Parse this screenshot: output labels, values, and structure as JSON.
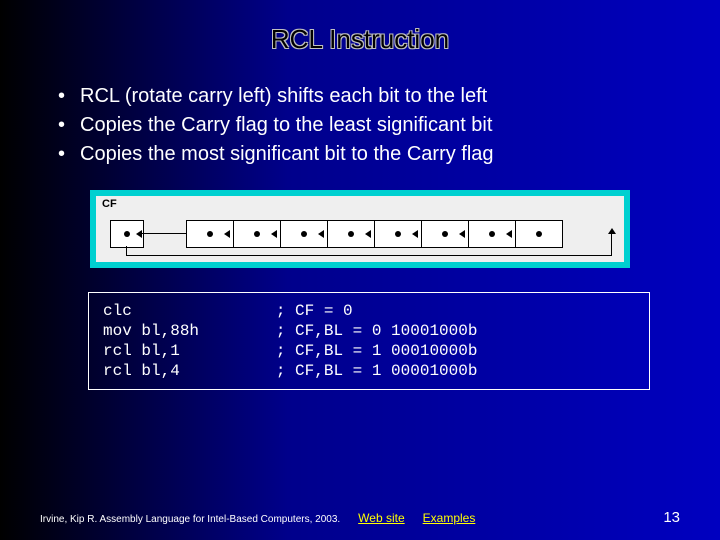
{
  "title": "RCL Instruction",
  "bullets": [
    "RCL (rotate carry left) shifts each bit to the left",
    "Copies the Carry flag to the least significant bit",
    "Copies the most significant bit to the Carry flag"
  ],
  "diagram": {
    "cf_label": "CF",
    "bit_count": 8
  },
  "code_lines": [
    {
      "instr": "clc",
      "comment": "; CF = 0"
    },
    {
      "instr": "mov bl,88h",
      "comment": "; CF,BL = 0 10001000b"
    },
    {
      "instr": "rcl bl,1",
      "comment": "; CF,BL = 1 00010000b"
    },
    {
      "instr": "rcl bl,4",
      "comment": "; CF,BL = 1 00001000b"
    }
  ],
  "footer": {
    "attribution": "Irvine, Kip R. Assembly Language for Intel-Based Computers, 2003.",
    "links": [
      "Web site",
      "Examples"
    ],
    "page_number": "13"
  }
}
